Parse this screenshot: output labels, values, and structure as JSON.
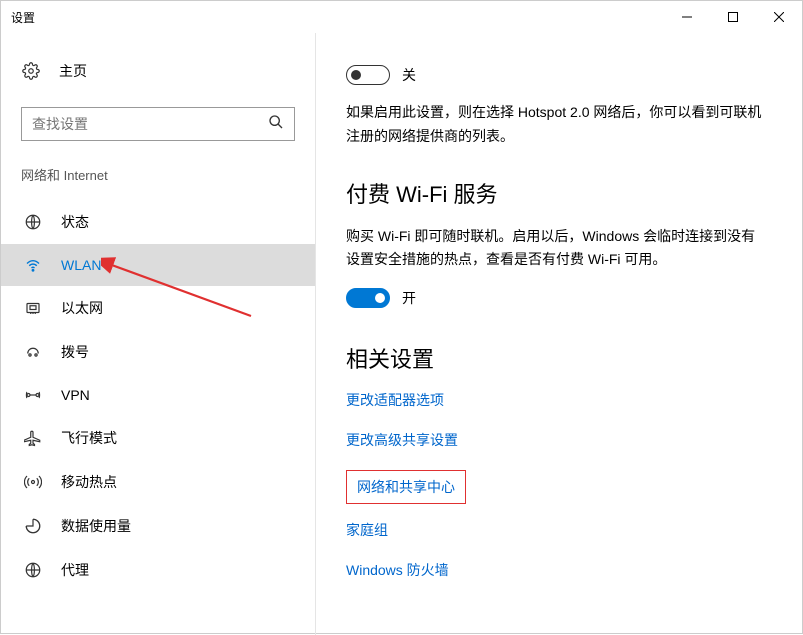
{
  "window": {
    "title": "设置"
  },
  "sidebar": {
    "home": "主页",
    "searchPlaceholder": "查找设置",
    "category": "网络和 Internet",
    "items": [
      {
        "label": "状态"
      },
      {
        "label": "WLAN"
      },
      {
        "label": "以太网"
      },
      {
        "label": "拨号"
      },
      {
        "label": "VPN"
      },
      {
        "label": "飞行模式"
      },
      {
        "label": "移动热点"
      },
      {
        "label": "数据使用量"
      },
      {
        "label": "代理"
      }
    ]
  },
  "content": {
    "toggle1": {
      "state": "off",
      "label": "关"
    },
    "desc1": "如果启用此设置，则在选择 Hotspot 2.0 网络后，你可以看到可联机注册的网络提供商的列表。",
    "section1": {
      "title": "付费 Wi-Fi 服务",
      "desc": "购买 Wi-Fi 即可随时联机。启用以后，Windows 会临时连接到没有设置安全措施的热点，查看是否有付费 Wi-Fi 可用。",
      "toggleLabel": "开"
    },
    "section2": {
      "title": "相关设置"
    },
    "links": {
      "adapter": "更改适配器选项",
      "sharing": "更改高级共享设置",
      "center": "网络和共享中心",
      "homegroup": "家庭组",
      "firewall": "Windows 防火墙"
    }
  }
}
